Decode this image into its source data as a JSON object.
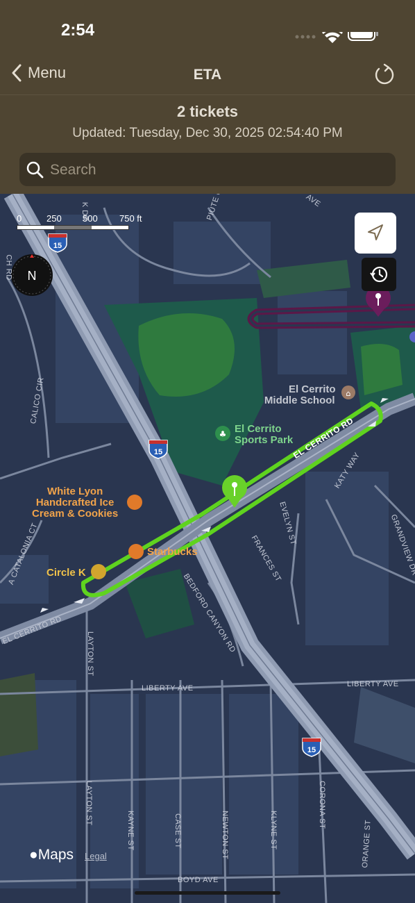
{
  "status": {
    "time": "2:54"
  },
  "nav": {
    "back_label": "Menu",
    "title": "ETA"
  },
  "summary": {
    "tickets": "2 tickets",
    "updated": "Updated: Tuesday, Dec 30, 2025 02:54:40 PM"
  },
  "search": {
    "placeholder": "Search"
  },
  "map": {
    "scale": [
      "0",
      "250",
      "500",
      "750 ft"
    ],
    "compass": "N",
    "highway_shield": "15",
    "streets": {
      "piute_creek": "PIUTE CREEK DR",
      "ave": "AVE",
      "ch_rd": "CH RD",
      "calico_cir": "CALICO CIR",
      "el_cerrito_rd_east": "EL CERRITO RD",
      "el_cerrito_rd_west": "EL CERRITO RD",
      "evelyn_st": "EVELYN ST",
      "katy_way": "KATY WAY",
      "frances_st": "FRANCES ST",
      "grandview_dr": "GRANDVIEW DR",
      "catalonia_ct": "A CATALONIA CT",
      "layton_st": "LAYTON ST",
      "layton_st_south": "LAYTON ST",
      "bedford_canyon_rd": "BEDFORD CANYON RD",
      "liberty_ave_west": "LIBERTY AVE",
      "liberty_ave_east": "LIBERTY AVE",
      "corona_st": "CORONA ST",
      "kayne_st": "KAYNE ST",
      "case_st": "CASE ST",
      "newton_st": "NEWTON ST",
      "klyne_st": "KLYNE ST",
      "orange_st": "ORANGE ST",
      "boyd_ave": "BOYD AVE",
      "dr_top": "K DR"
    },
    "pois": {
      "middle_school_line1": "El Cerrito",
      "middle_school_line2": "Middle School",
      "sports_park_line1": "El Cerrito",
      "sports_park_line2": "Sports Park",
      "white_lyon_line1": "White Lyon",
      "white_lyon_line2": "Handcrafted Ice",
      "white_lyon_line3": "Cream & Cookies",
      "starbucks": "Starbucks",
      "circle_k": "Circle K"
    },
    "attribution": {
      "maps": "Maps",
      "legal": "Legal"
    }
  },
  "colors": {
    "header": "#4f4532",
    "map_bg": "#2a3650",
    "route_green": "#5fd31f",
    "route_purple": "#5a1848"
  }
}
